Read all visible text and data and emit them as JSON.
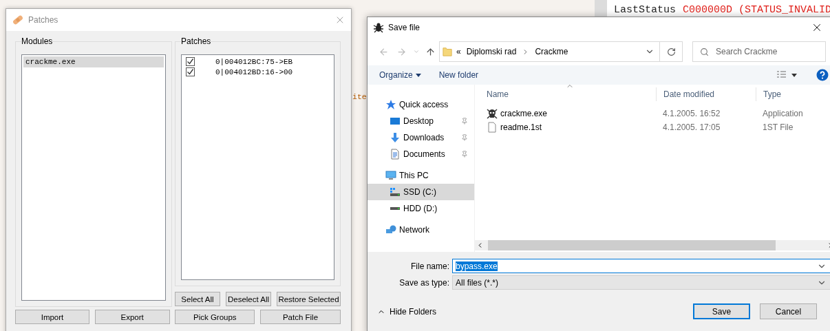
{
  "background": {
    "status_label": "LastStatus",
    "status_value": "C000000D (STATUS_INVALID",
    "code_fragment": "ite"
  },
  "patches_window": {
    "title": "Patches",
    "modules": {
      "label": "Modules",
      "items": [
        {
          "name": "crackme.exe",
          "selected": true
        }
      ]
    },
    "patches": {
      "label": "Patches",
      "items": [
        {
          "text": "0|004012BC:75->EB",
          "checked": true
        },
        {
          "text": "0|004012BD:16->00",
          "checked": true
        }
      ]
    },
    "list_buttons": [
      "Select All",
      "Deselect All",
      "Restore Selected"
    ],
    "footer_buttons": [
      "Import",
      "Export",
      "Pick Groups",
      "Patch File"
    ]
  },
  "save_dialog": {
    "title": "Save file",
    "address": {
      "prefix": "«",
      "segments": [
        "Diplomski rad",
        "Crackme"
      ]
    },
    "search": {
      "placeholder": "Search Crackme"
    },
    "toolbar": {
      "organize": "Organize",
      "new_folder": "New folder"
    },
    "navigation": [
      {
        "label": "Quick access",
        "kind": "star",
        "selected": false,
        "pinned": false,
        "children": [
          {
            "label": "Desktop",
            "kind": "desktop",
            "selected": false,
            "pinned": true
          },
          {
            "label": "Downloads",
            "kind": "download",
            "selected": false,
            "pinned": true
          },
          {
            "label": "Documents",
            "kind": "document",
            "selected": false,
            "pinned": true
          }
        ]
      },
      {
        "label": "This PC",
        "kind": "pc",
        "selected": false,
        "pinned": false,
        "children": [
          {
            "label": "SSD (C:)",
            "kind": "ssd",
            "selected": true,
            "pinned": false
          },
          {
            "label": "HDD (D:)",
            "kind": "hdd",
            "selected": false,
            "pinned": false
          }
        ]
      },
      {
        "label": "Network",
        "kind": "network",
        "selected": false,
        "pinned": false
      }
    ],
    "columns": [
      "Name",
      "Date modified",
      "Type"
    ],
    "files": [
      {
        "name": "crackme.exe",
        "kind": "application",
        "date": "4.1.2005. 16:52",
        "type": "Application"
      },
      {
        "name": "readme.1st",
        "kind": "document",
        "date": "4.1.2005. 17:05",
        "type": "1ST File"
      }
    ],
    "file_name": {
      "label": "File name:",
      "value": "bypass.exe",
      "selected": true
    },
    "save_as_type": {
      "label": "Save as type:",
      "value": "All files (*.*)"
    },
    "hide_folders": "Hide Folders",
    "buttons": [
      {
        "label": "Save",
        "default": true
      },
      {
        "label": "Cancel",
        "default": false
      }
    ]
  }
}
